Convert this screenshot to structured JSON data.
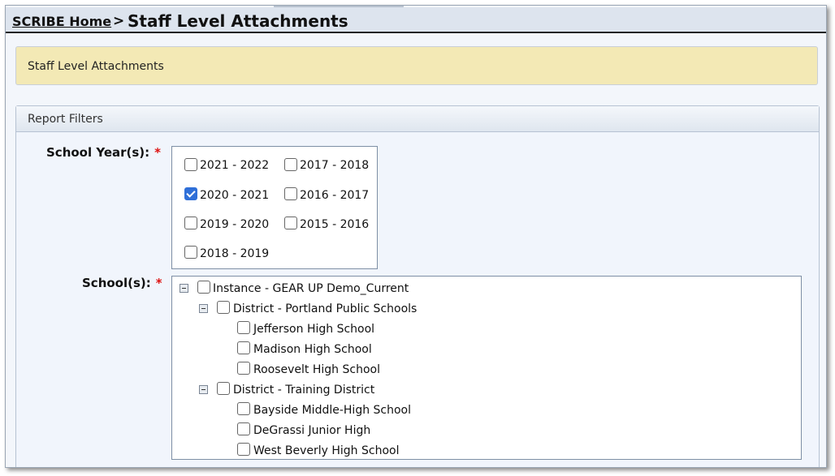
{
  "breadcrumb": {
    "home": "SCRIBE Home",
    "separator": ">"
  },
  "page_title": "Staff Level Attachments",
  "banner": "Staff Level Attachments",
  "filters": {
    "heading": "Report Filters",
    "school_years": {
      "label": "School Year(s):",
      "required": "*",
      "options": [
        {
          "label": "2021 - 2022",
          "checked": false
        },
        {
          "label": "2017 - 2018",
          "checked": false
        },
        {
          "label": "2020 - 2021",
          "checked": true
        },
        {
          "label": "2016 - 2017",
          "checked": false
        },
        {
          "label": "2019 - 2020",
          "checked": false
        },
        {
          "label": "2015 - 2016",
          "checked": false
        },
        {
          "label": "2018 - 2019",
          "checked": false
        }
      ]
    },
    "schools": {
      "label": "School(s):",
      "required": "*",
      "tree": [
        {
          "label": "Instance - GEAR UP Demo_Current",
          "checked": false,
          "collapsible": true
        },
        {
          "label": "District - Portland Public Schools",
          "checked": false,
          "collapsible": true
        },
        {
          "label": "Jefferson High School",
          "checked": false
        },
        {
          "label": "Madison High School",
          "checked": false
        },
        {
          "label": "Roosevelt High School",
          "checked": false
        },
        {
          "label": "District - Training District",
          "checked": false,
          "collapsible": true
        },
        {
          "label": "Bayside Middle-High School",
          "checked": false
        },
        {
          "label": "DeGrassi Junior High",
          "checked": false
        },
        {
          "label": "West Beverly High School",
          "checked": false
        }
      ]
    }
  }
}
